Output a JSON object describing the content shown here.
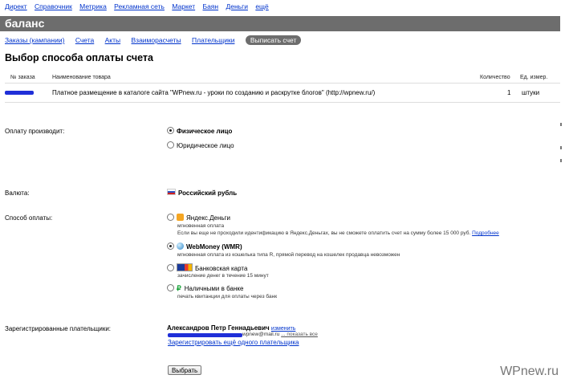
{
  "topnav": [
    "Директ",
    "Справочник",
    "Метрика",
    "Рекламная сеть",
    "Маркет",
    "Баян",
    "Деньги",
    "ещё"
  ],
  "page_header": "баланс",
  "subnav": {
    "items": [
      "Заказы (кампании)",
      "Счета",
      "Акты",
      "Взаиморасчеты",
      "Плательщики"
    ],
    "active": "Выписать счет"
  },
  "page_title": "Выбор способа оплаты счета",
  "table": {
    "headers": {
      "order": "№ заказа",
      "product": "Наименование товара",
      "qty": "Количество",
      "unit": "Ед. измер."
    },
    "row": {
      "product": "Платное размещение в каталоге сайта \"WPnew.ru - уроки по созданию и раскрутке блогов\" (http://wpnew.ru/)",
      "qty": "1",
      "unit": "штуки"
    }
  },
  "payer": {
    "label": "Оплату производит:",
    "options": [
      {
        "label": "Физическое лицо",
        "selected": true
      },
      {
        "label": "Юридическое лицо",
        "selected": false
      }
    ]
  },
  "currency": {
    "label": "Валюта:",
    "value": "Российский рубль"
  },
  "payment": {
    "label": "Способ оплаты:",
    "options": [
      {
        "icon": "yandex-money-icon",
        "label": "Яндекс.Деньги",
        "sub": "мгновенная оплата",
        "note": "Если вы еще не проходили идентификацию в Яндекс.Деньгах, вы не сможете оплатить счет на сумму более 15 000 руб.",
        "link": "Подробнее",
        "selected": false
      },
      {
        "icon": "webmoney-icon",
        "label": "WebMoney (WMR)",
        "sub": "мгновенная оплата из кошелька типа R, прямой перевод на кошелек продавца невозможен",
        "selected": true
      },
      {
        "icon": "bank-card-icon",
        "label": "Банковская карта",
        "sub": "зачисление денег в течение 15 минут",
        "selected": false
      },
      {
        "icon": "cash-icon",
        "label": "Наличными в банке",
        "sub": "печать квитанции для оплаты через банк",
        "selected": false
      }
    ]
  },
  "registered": {
    "label": "Зарегистрированные плательщики:",
    "name": "Александров Петр Геннадьевич",
    "edit": "изменить",
    "email": "wpnew@mail.ru",
    "show_all": "... показать все",
    "add": "Зарегистрировать ещё одного плательщика"
  },
  "submit": "Выбрать",
  "watermark": "WPnew.ru",
  "colors": {
    "header_bar": "#6d6d6d",
    "link": "#0033cc",
    "redaction": "#1f2fd8"
  }
}
